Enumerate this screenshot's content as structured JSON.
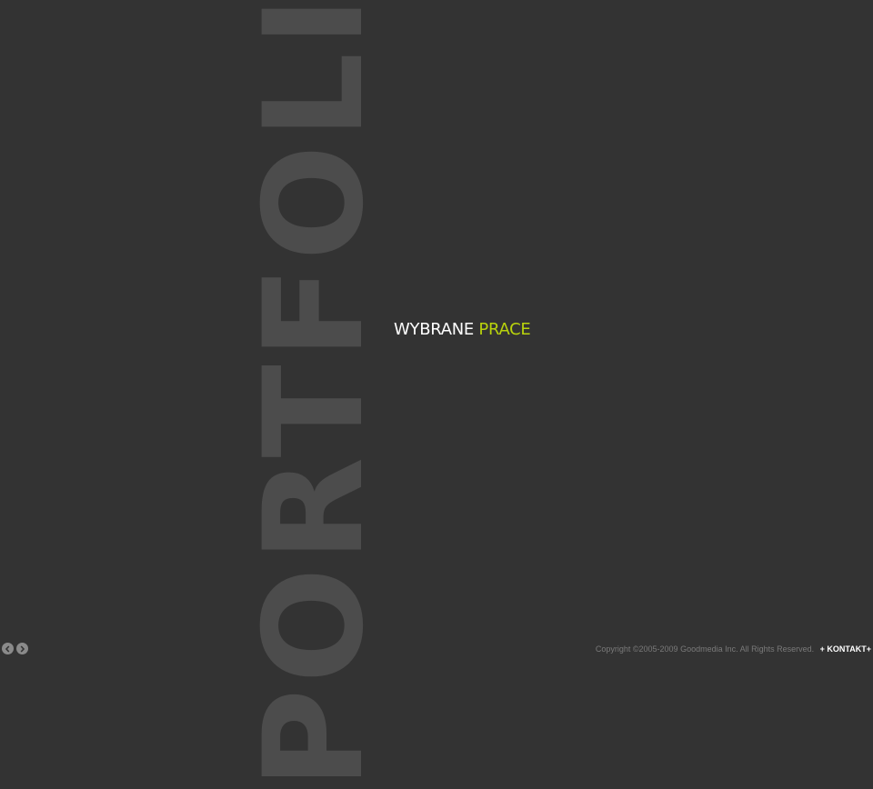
{
  "background_word": "PORTFOLIO",
  "heading": {
    "part1": "WYBRANE",
    "part2": "PRACE"
  },
  "nav": {
    "prev_icon": "chevron-left-icon",
    "next_icon": "chevron-right-icon"
  },
  "footer": {
    "copyright": "Copyright ©2005-2009 Goodmedia Inc. All Rights Reserved.",
    "kontakt": "+ KONTAKT+"
  },
  "colors": {
    "background": "#333333",
    "accent": "#b9d30c",
    "portfolio_text": "#4c4c4c"
  }
}
